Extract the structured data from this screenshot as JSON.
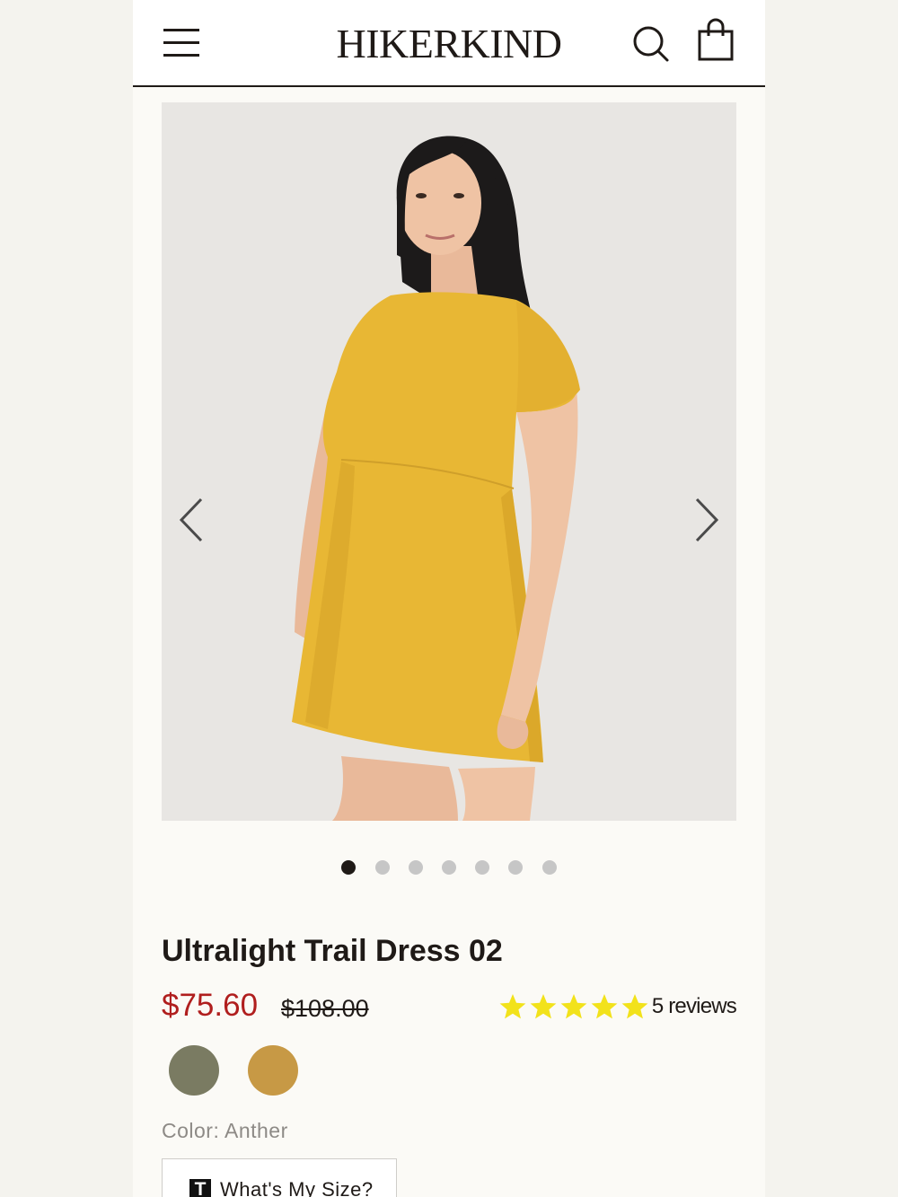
{
  "header": {
    "logo": "HIKERKIND",
    "menu_icon": "hamburger-menu-icon",
    "search_icon": "search-icon",
    "cart_icon": "shopping-bag-icon"
  },
  "gallery": {
    "prev_icon": "chevron-left-icon",
    "next_icon": "chevron-right-icon",
    "total_images": 7,
    "active_index": 0,
    "dress_color": "#E8B734"
  },
  "product": {
    "title": "Ultralight Trail Dress 02",
    "sale_price": "$75.60",
    "original_price": "$108.00",
    "rating": 5,
    "reviews_label": "5 reviews",
    "swatches": [
      {
        "color": "#7A7B62"
      },
      {
        "color": "#C79945"
      }
    ],
    "color_label": "Color: Anther",
    "size_button": {
      "icon": "T",
      "label": "What's My Size?"
    }
  },
  "colors": {
    "sale_price": "#B01E1E",
    "star": "#F2E21B",
    "text": "#1F1A17"
  }
}
